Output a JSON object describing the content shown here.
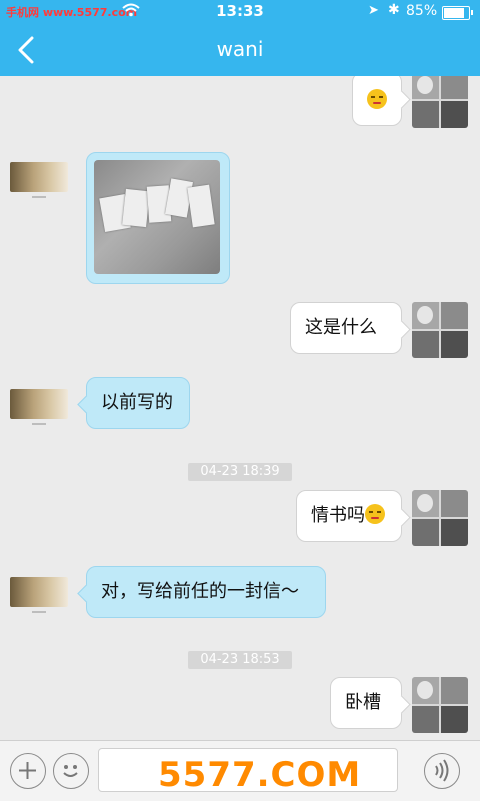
{
  "status": {
    "carrier": "手机网 www.5577.com",
    "time": "13:33",
    "battery_pct": "85%",
    "battery_level": 0.85
  },
  "nav": {
    "title": "wani"
  },
  "messages": {
    "m2": "这是什么",
    "m3": "以前写的",
    "ts1": "04-23 18:39",
    "m4": "情书吗",
    "m5": "对，写给前任的一封信～",
    "ts2": "04-23 18:53",
    "m6": "卧槽"
  },
  "icons": {
    "back": "chevron-left-icon",
    "plus": "plus-icon",
    "emoji": "smiley-icon",
    "voice": "voice-icon"
  },
  "watermark": "5577.COM",
  "colors": {
    "accent": "#36b6ee",
    "bubble_other": "#bfe9f8"
  }
}
